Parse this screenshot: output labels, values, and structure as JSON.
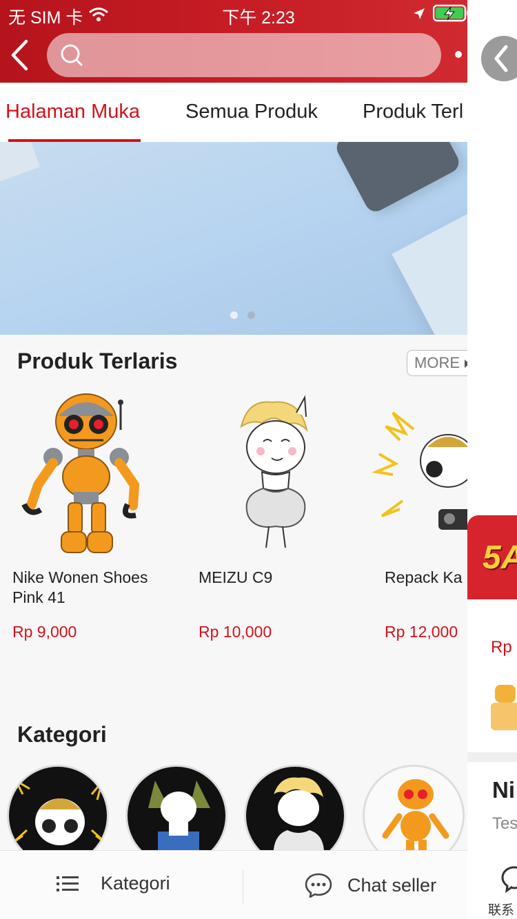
{
  "status_bar": {
    "carrier": "无 SIM 卡",
    "time": "下午 2:23"
  },
  "header": {
    "search_placeholder": ""
  },
  "tabs": [
    {
      "label": "Halaman Muka",
      "active": true
    },
    {
      "label": "Semua Produk",
      "active": false
    },
    {
      "label": "Produk Terl",
      "active": false
    }
  ],
  "banner": {
    "slide_count": 2,
    "active_slide": 1
  },
  "best_sellers": {
    "title": "Produk Terlaris",
    "more_label": "MORE",
    "products": [
      {
        "name": "Nike Wonen Shoes Pink 41",
        "price": "Rp 9,000",
        "image": "orange-robot-toy"
      },
      {
        "name": "MEIZU C9",
        "price": "Rp 10,000",
        "image": "unicorn-marilyn"
      },
      {
        "name": "Repack Ka",
        "price": "Rp 12,000",
        "image": "unicorn-dj"
      }
    ]
  },
  "categories": {
    "title": "Kategori",
    "items": [
      "unicorn-dj",
      "unicorn-chandelier",
      "unicorn-marilyn",
      "orange-robot-toy"
    ]
  },
  "bottom_bar": {
    "category_label": "Kategori",
    "chat_label": "Chat seller"
  },
  "side_panel": {
    "promo_text": "5A",
    "price_prefix": "Rp",
    "title_fragment": "Ni",
    "subtitle_fragment": "Tes",
    "contact_fragment": "联系"
  },
  "colors": {
    "brand_red": "#d0121b",
    "header_red": "#c51b24"
  }
}
